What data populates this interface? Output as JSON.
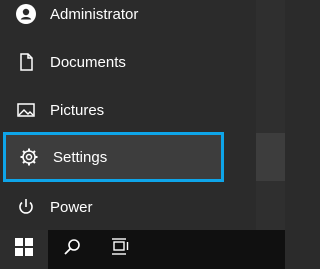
{
  "menu": {
    "items": [
      {
        "label": "Administrator",
        "icon": "user-avatar-icon"
      },
      {
        "label": "Documents",
        "icon": "document-icon"
      },
      {
        "label": "Pictures",
        "icon": "image-icon"
      },
      {
        "label": "Settings",
        "icon": "gear-icon",
        "selected": true
      },
      {
        "label": "Power",
        "icon": "power-icon"
      }
    ]
  },
  "taskbar": {
    "buttons": [
      "windows-start-icon",
      "search-icon",
      "task-view-icon"
    ]
  },
  "colors": {
    "menu_bg": "#2b2b2b",
    "hover_bg": "#3d3d3d",
    "accent": "#0ea5e9",
    "taskbar_bg": "#101010",
    "text": "#ffffff"
  }
}
